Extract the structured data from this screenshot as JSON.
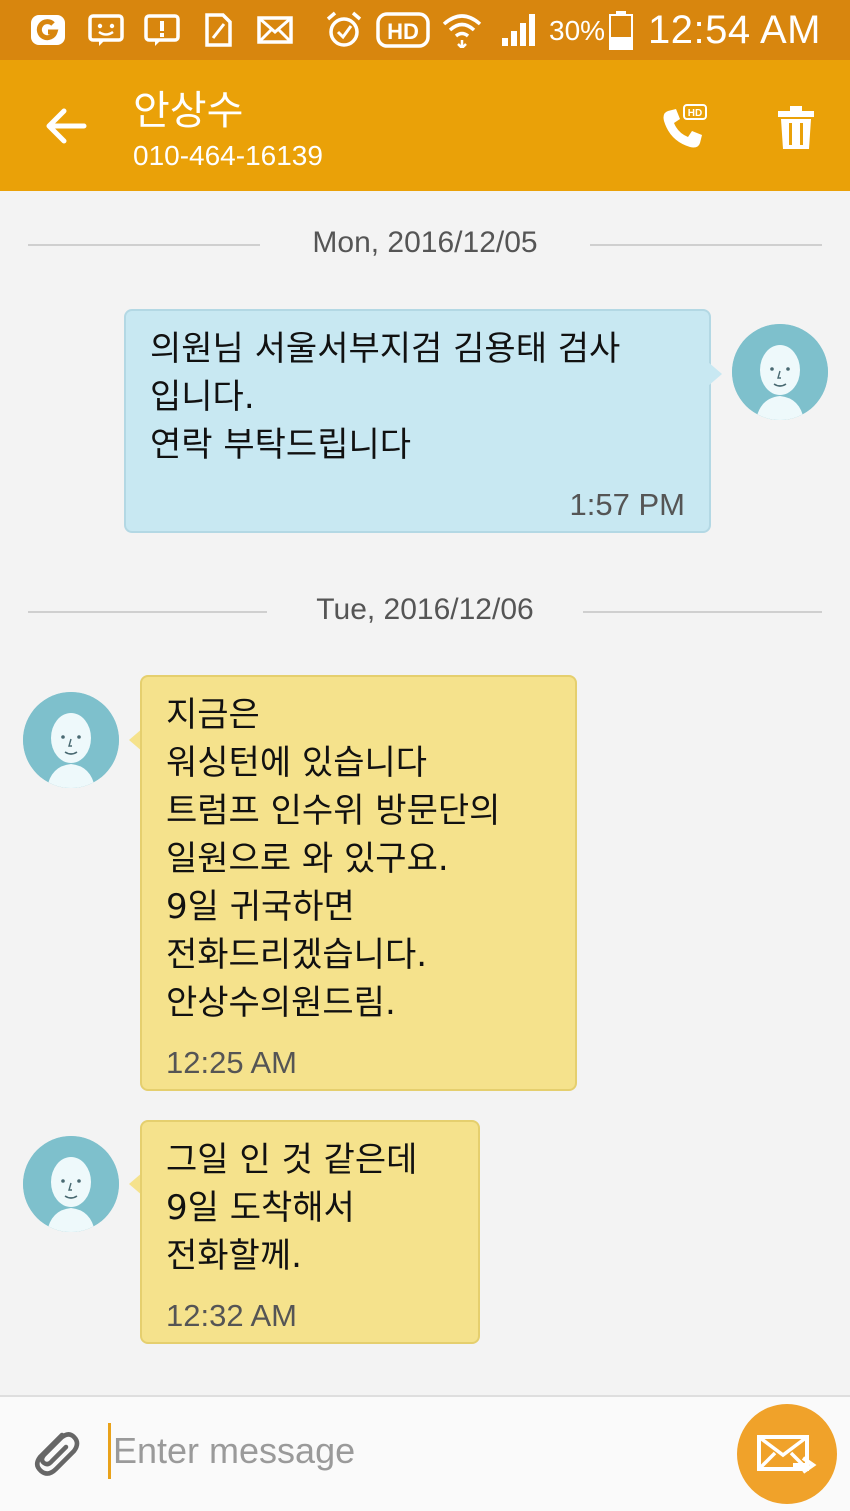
{
  "status_bar": {
    "battery_percent": "30%",
    "time": "12:54 AM",
    "icons": [
      "carrier-app-icon",
      "messenger-icon",
      "alert-icon",
      "sim-icon",
      "mail-icon",
      "alarm-icon",
      "hd-voice-icon",
      "wifi-icon",
      "signal-icon",
      "battery-icon"
    ]
  },
  "header": {
    "contact_name": "안상수",
    "contact_number": "010-464-16139",
    "icons": [
      "back-arrow-icon",
      "hd-call-icon",
      "trash-icon"
    ]
  },
  "colors": {
    "status_bar_bg": "#d8860e",
    "header_bg": "#eaa108",
    "sent_bubble_bg": "#c8e8f2",
    "received_bubble_bg": "#f5e28c",
    "send_button_bg": "#f0a22a"
  },
  "conversation": {
    "dates": [
      "Mon, 2016/12/05",
      "Tue, 2016/12/06"
    ],
    "messages": [
      {
        "direction": "sent",
        "text": "의원님 서울서부지검 김용태 검사\n입니다.\n연락 부탁드립니다",
        "time": "1:57 PM"
      },
      {
        "direction": "received",
        "text": "지금은\n워싱턴에 있습니다\n트럼프 인수위 방문단의\n일원으로 와 있구요.\n9일 귀국하면\n전화드리겠습니다.\n안상수의원드림.",
        "time": "12:25 AM"
      },
      {
        "direction": "received",
        "text": "그일 인 것 같은데\n9일 도착해서\n전화할께.",
        "time": "12:32 AM"
      }
    ]
  },
  "composer": {
    "placeholder": "Enter message",
    "icons": [
      "paperclip-icon",
      "send-message-icon"
    ]
  }
}
